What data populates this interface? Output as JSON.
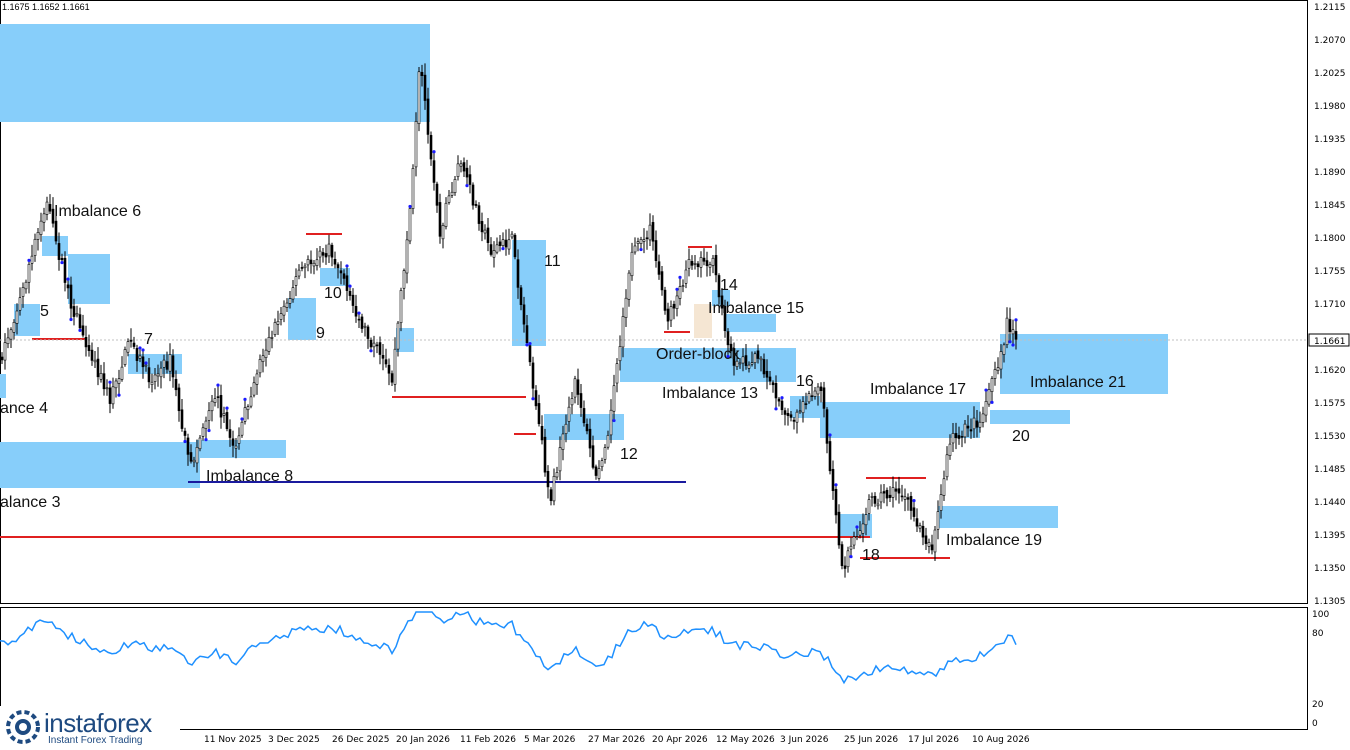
{
  "header": {
    "ohlc_text": "1.1675 1.1652 1.1661"
  },
  "price_axis": {
    "ticks": [
      "1.2115",
      "1.2070",
      "1.2025",
      "1.1980",
      "1.1935",
      "1.1890",
      "1.1845",
      "1.1800",
      "1.1755",
      "1.1710",
      "1.1620",
      "1.1575",
      "1.1530",
      "1.1485",
      "1.1440",
      "1.1395",
      "1.1350",
      "1.1305"
    ],
    "current_price": "1.1661",
    "current_marker_color": "#ffffff"
  },
  "indicator_axis": {
    "ticks": [
      "100",
      "80",
      "20",
      "0"
    ]
  },
  "time_axis": {
    "labels": [
      "11 Nov 2025",
      "3 Dec 2025",
      "26 Dec 2025",
      "20 Jan 2026",
      "11 Feb 2026",
      "5 Mar 2026",
      "27 Mar 2026",
      "20 Apr 2026",
      "12 May 2026",
      "3 Jun 2026",
      "25 Jun 2026",
      "17 Jul 2026",
      "10 Aug 2026"
    ]
  },
  "zone_labels": {
    "imbalance_6": "Imbalance 6",
    "z5": "5",
    "z7": "7",
    "imbalance_4": "ance 4",
    "imbalance_3": "alance 3",
    "imbalance_8": "Imbalance 8",
    "z9": "9",
    "z10": "10",
    "z11": "11",
    "z12": "12",
    "order_block": "Order-block",
    "imbalance_13": "Imbalance 13",
    "z14": "14",
    "imbalance_15": "Imbalance 15",
    "z16": "16",
    "imbalance_17": "Imbalance 17",
    "z18": "18",
    "imbalance_19": "Imbalance 19",
    "z20": "20",
    "imbalance_21": "Imbalance 21"
  },
  "colors": {
    "zone_blue": "#87cefa",
    "order_block": "#f5e6d3",
    "level_red": "#e02020",
    "level_navy": "#1a1a9e",
    "candle": "#000000",
    "indicator_line": "#1e90ff",
    "wick_tip": "#1a1aff"
  },
  "branding": {
    "name": "instaforex",
    "tagline": "Instant Forex Trading",
    "icon": "gear-logo-icon"
  }
}
